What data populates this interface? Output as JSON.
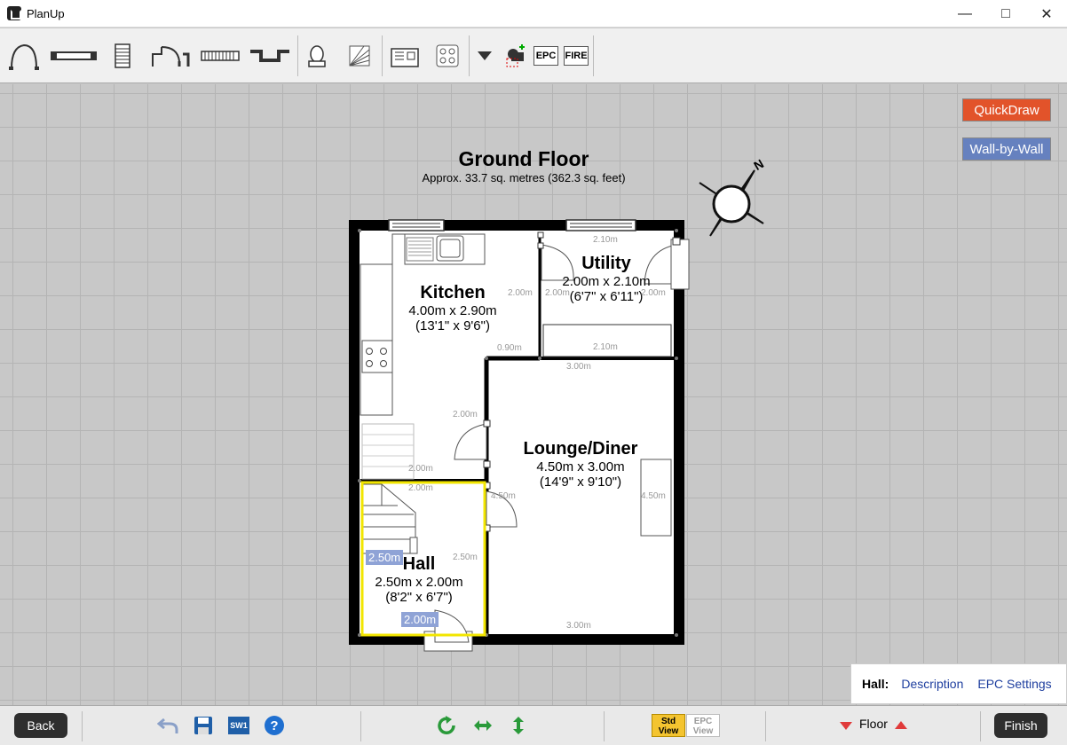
{
  "window": {
    "title": "PlanUp"
  },
  "toolbar": {
    "epc": "EPC",
    "fire": "FIRE"
  },
  "right_buttons": {
    "quickdraw": "QuickDraw",
    "wall_by_wall": "Wall-by-Wall"
  },
  "floor": {
    "title": "Ground Floor",
    "area": "Approx. 33.7 sq. metres (362.3 sq. feet)"
  },
  "compass": {
    "north_label": "N"
  },
  "rooms": {
    "kitchen": {
      "name": "Kitchen",
      "size": "4.00m x 2.90m",
      "imperial": "(13'1\" x 9'6\")"
    },
    "utility": {
      "name": "Utility",
      "size": "2.00m x 2.10m",
      "imperial": "(6'7\" x 6'11\")"
    },
    "lounge": {
      "name": "Lounge/Diner",
      "size": "4.50m x 3.00m",
      "imperial": "(14'9\" x 9'10\")"
    },
    "hall": {
      "name": "Hall",
      "size": "2.50m x 2.00m",
      "imperial": "(8'2\" x 6'7\")"
    }
  },
  "dimensions": {
    "utility_top": "2.10m",
    "utility_left_a": "2.00m",
    "utility_left_b": "2.00m",
    "utility_right": "2.00m",
    "utility_bottom": "2.10m",
    "kitchen_step": "0.90m",
    "lounge_top": "3.00m",
    "kitchen_mid": "2.00m",
    "stairs_a": "2.00m",
    "stairs_b": "2.00m",
    "hall_door": "4.50m",
    "lounge_right": "4.50m",
    "hall_right": "2.50m",
    "lounge_bottom": "3.00m",
    "hall_left_hl": "2.50m",
    "hall_bottom_hl": "2.00m"
  },
  "properties": {
    "selected": "Hall:",
    "description": "Description",
    "epc_settings": "EPC Settings"
  },
  "bottom": {
    "back": "Back",
    "sw1": "SW1",
    "std_view_a": "Std",
    "std_view_b": "View",
    "epc_view_a": "EPC",
    "epc_view_b": "View",
    "floor": "Floor",
    "finish": "Finish"
  },
  "colors": {
    "quickdraw": "#e2532a",
    "wall_by_wall": "#6681bf",
    "selection": "#f2e600",
    "std_view": "#f4c430"
  }
}
